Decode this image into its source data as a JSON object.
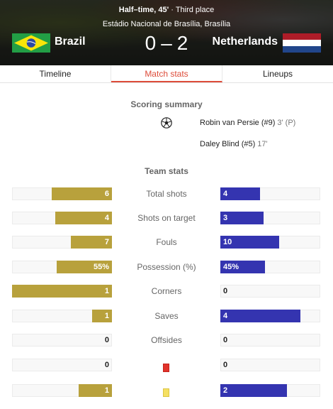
{
  "match": {
    "status": "Half–time, 45'",
    "separator": " · ",
    "stage": "Third place",
    "venue": "Estádio Nacional de Brasília, Brasília",
    "home": {
      "name": "Brazil",
      "score": "0",
      "flag": "brazil-flag",
      "color": "#b8a13c"
    },
    "away": {
      "name": "Netherlands",
      "score": "2",
      "flag": "netherlands-flag",
      "color": "#3434b0"
    },
    "score_separator": "–"
  },
  "tabs": [
    {
      "label": "Timeline",
      "active": false
    },
    {
      "label": "Match stats",
      "active": true
    },
    {
      "label": "Lineups",
      "active": false
    }
  ],
  "scoring_summary": {
    "title": "Scoring summary",
    "icon": "soccer-ball-icon",
    "goals": [
      {
        "player": "Robin van Persie (#9)",
        "minute": "3' (P)"
      },
      {
        "player": "Daley Blind (#5)",
        "minute": "17'"
      }
    ]
  },
  "team_stats": {
    "title": "Team stats",
    "rows": [
      {
        "label": "Total shots",
        "home": "6",
        "away": "4",
        "home_fraction": 0.6,
        "away_fraction": 0.4
      },
      {
        "label": "Shots on target",
        "home": "4",
        "away": "3",
        "home_fraction": 0.57,
        "away_fraction": 0.43
      },
      {
        "label": "Fouls",
        "home": "7",
        "away": "10",
        "home_fraction": 0.41,
        "away_fraction": 0.59
      },
      {
        "label": "Possession (%)",
        "home": "55%",
        "away": "45%",
        "home_fraction": 0.55,
        "away_fraction": 0.45
      },
      {
        "label": "Corners",
        "home": "1",
        "away": "0",
        "home_fraction": 1.0,
        "away_fraction": 0.0
      },
      {
        "label": "Saves",
        "home": "1",
        "away": "4",
        "home_fraction": 0.2,
        "away_fraction": 0.8
      },
      {
        "label": "Offsides",
        "home": "0",
        "away": "0",
        "home_fraction": 0.0,
        "away_fraction": 0.0
      },
      {
        "label": "",
        "icon": "red-card-icon",
        "home": "0",
        "away": "0",
        "home_fraction": 0.0,
        "away_fraction": 0.0
      },
      {
        "label": "",
        "icon": "yellow-card-icon",
        "home": "1",
        "away": "2",
        "home_fraction": 0.33,
        "away_fraction": 0.67
      }
    ]
  }
}
